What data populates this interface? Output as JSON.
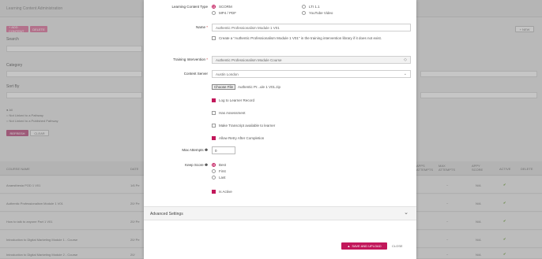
{
  "background": {
    "window_title": "Learning Content Administration",
    "add_content_label": "+ ADD CONTENT",
    "delete_label": "DELETE",
    "new_label": "+ NEW",
    "filters": {
      "search_label": "Search",
      "category_label": "Category",
      "sort_label": "Sort By",
      "radios": [
        "All",
        "Not Linked to a Pathway",
        "Not Linked to a Published Pathway"
      ],
      "refresh_label": "REFRESH",
      "clear_label": "CLEAR"
    },
    "table": {
      "headers": [
        "COURSE NAME",
        "DATE",
        "APPS ATTEMPTS",
        "MAX ATTEMPTS",
        "APPY SCORE",
        "ACTIVE",
        "DELETE"
      ],
      "rows": [
        {
          "name": "Anaesthesia POD 1 V01",
          "date": "1/6 Pe",
          "max": "~",
          "score": "N/A",
          "active": "✔"
        },
        {
          "name": "Authentic Professionalism Module 1 V01",
          "date": "20/ Pe",
          "max": "~",
          "score": "N/A",
          "active": "✔"
        },
        {
          "name": "How to talk to anyone Part 1 V01",
          "date": "20/ Pe",
          "max": "~",
          "score": "N/A",
          "active": "✔"
        },
        {
          "name": "Introduction to Digital Marketing Module 1 - Course",
          "date": "20/ Pe",
          "max": "~",
          "score": "N/A",
          "active": "✔"
        },
        {
          "name": "Introduction to Digital Marketing Module 2 - Course",
          "date": "20/",
          "max": "~",
          "score": "N/A",
          "active": "✔"
        }
      ]
    }
  },
  "modal": {
    "content_type": {
      "label": "Learning Content Type",
      "options": [
        "SCORM",
        "MP4 / PDF",
        "LTI 1.1",
        "YouTube Video"
      ],
      "selected": "SCORM"
    },
    "name": {
      "label": "Name",
      "required_mark": "*",
      "value": "Authentic Professionalism Module 1 V01",
      "library_checkbox_label": "Create a \"Authentic Professionalism Module 1 V01\" in the training intervention library if it does not exist."
    },
    "training_intervention": {
      "label": "Training Intervention",
      "required_mark": "*",
      "value": "Authentic Professionalism Module Course"
    },
    "content_server": {
      "label": "Content Server",
      "value": "Austin London"
    },
    "file": {
      "button_label": "Choose File",
      "file_name": "Authentic Pr...ule 1 V01.zip"
    },
    "checkboxes": [
      {
        "label": "Log to Learner Record",
        "checked": true
      },
      {
        "label": "Has Assessment",
        "checked": false
      },
      {
        "label": "Make Transcript available to learner",
        "checked": false
      },
      {
        "label": "Allow Retry After Completion",
        "checked": true
      }
    ],
    "max_attempts": {
      "label": "Max Attempts",
      "value": "0"
    },
    "keep_score": {
      "label": "Keep Score",
      "options": [
        "Best",
        "First",
        "Last"
      ],
      "selected": "Best"
    },
    "is_active_label": "Is Active",
    "advanced_settings_label": "Advanced Settings",
    "save_label": "SAVE AND UPLOAD",
    "close_label": "CLOSE"
  },
  "colors": {
    "accent": "#c2185b",
    "check_green": "#6b9a3c"
  }
}
